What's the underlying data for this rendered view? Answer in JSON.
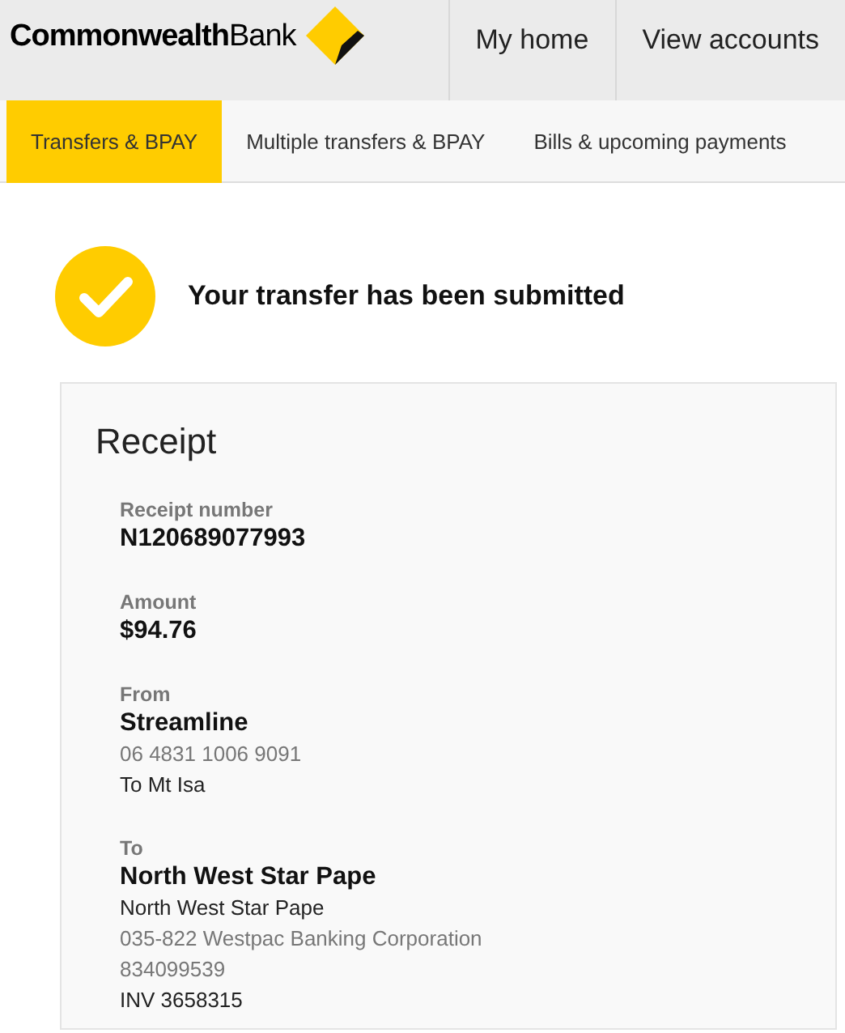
{
  "logo": {
    "text": "**Commonwealth**Bank"
  },
  "nav": [
    {
      "label": "My home"
    },
    {
      "label": "View accounts"
    }
  ],
  "tabs": [
    {
      "label": "Transfers & BPAY",
      "selected": true
    },
    {
      "label": "Multiple transfers & BPAY",
      "selected": false
    },
    {
      "label": "Bills & upcoming payments",
      "selected": false
    }
  ],
  "status": {
    "message": "Your transfer has been submitted"
  },
  "receipt": {
    "title": "Receipt",
    "sections": [
      {
        "label": "Receipt number",
        "lines": [
          {
            "kind": "primary",
            "text": "N120689077993"
          }
        ]
      },
      {
        "label": "Amount",
        "lines": [
          {
            "kind": "primary",
            "text": "$94.76"
          }
        ]
      },
      {
        "label": "From",
        "lines": [
          {
            "kind": "primary",
            "text": "Streamline"
          },
          {
            "kind": "muted",
            "text": "06 4831 1006 9091"
          },
          {
            "kind": "plain",
            "text": "To Mt Isa"
          }
        ]
      },
      {
        "label": "To",
        "lines": [
          {
            "kind": "primary",
            "text": "North West Star Pape"
          },
          {
            "kind": "plain",
            "text": "North West Star Pape"
          },
          {
            "kind": "muted",
            "text": "035-822 Westpac Banking Corporation"
          },
          {
            "kind": "muted",
            "text": "834099539"
          },
          {
            "kind": "plain",
            "text": "INV 3658315"
          }
        ]
      }
    ]
  }
}
